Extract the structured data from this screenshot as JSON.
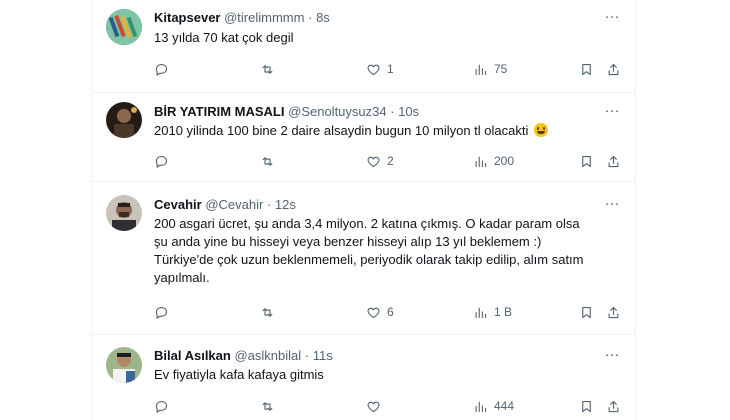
{
  "tweets": [
    {
      "display_name": "Kitapsever",
      "handle": "@tirelimmmm",
      "time": "8s",
      "lines": [
        "13 yılda 70 kat çok degil"
      ],
      "replies": "",
      "retweets": "",
      "likes": "1",
      "views": "75",
      "avatar_color": "#3b8f6a"
    },
    {
      "display_name": "BİR YATIRIM MASALI",
      "handle": "@Senoltuysuz34",
      "time": "10s",
      "lines": [
        "2010 yilinda 100 bine 2 daire alsaydin bugun 10 milyon tl  olacakti"
      ],
      "emoji": "grinning-face-emoji",
      "replies": "",
      "retweets": "",
      "likes": "2",
      "views": "200",
      "avatar_color": "#3a2a1e"
    },
    {
      "display_name": "Cevahir",
      "handle": "@Cevahir",
      "time": "12s",
      "lines": [
        "200 asgari ücret, şu anda 3,4 milyon. 2 katına çıkmış. O kadar param olsa",
        "şu anda yine bu hisseyi veya benzer hisseyi alıp 13 yıl beklemem :)",
        "Türkiye'de çok uzun beklenmemeli, periyodik olarak takip edilip, alım satım",
        "yapılmalı."
      ],
      "replies": "",
      "retweets": "",
      "likes": "6",
      "views": "1 B",
      "avatar_color": "#5a4636"
    },
    {
      "display_name": "Bilal Asılkan",
      "handle": "@aslknbilal",
      "time": "11s",
      "lines": [
        "Ev fiyatiyla kafa kafaya gitmis"
      ],
      "replies": "",
      "retweets": "",
      "likes": "",
      "views": "444",
      "avatar_color": "#6b8a5a"
    }
  ],
  "colors": {
    "text": "#0f1419",
    "muted": "#536471",
    "divider": "#eff3f4"
  }
}
